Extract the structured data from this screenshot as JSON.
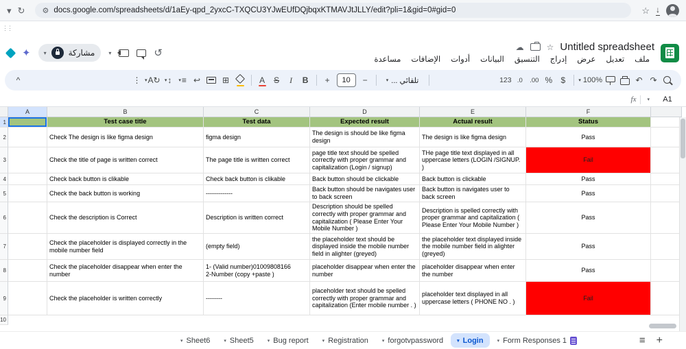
{
  "colors": {
    "header_green": "#a3c47f",
    "fail_red": "#ff0000",
    "active_blue": "#0b57d0",
    "active_tab_bg": "#d3e3fd",
    "toolbar_bg": "#edf2fa",
    "selection_blue": "#1a73e8",
    "sheets_green": "#118c46"
  },
  "browser": {
    "url": "docs.google.com/spreadsheets/d/1aEy-qpd_2yxcC-TXQCU3YJwEUfDQjbqxKTMAVJtJLLY/edit?pli=1&gid=0#gid=0"
  },
  "app": {
    "title": "Untitled spreadsheet",
    "share_label": "مشاركة",
    "menus": [
      "ملف",
      "تعديل",
      "عرض",
      "إدراج",
      "التنسيق",
      "البيانات",
      "أدوات",
      "الإضافات",
      "مساعدة"
    ]
  },
  "toolbar": {
    "font_size": "10",
    "font_name": "تلقائي ...",
    "zoom": "100%",
    "number_format": "123",
    "percent": "%",
    "currency": "$",
    "dec_decrease": ".0",
    "dec_increase": ".00",
    "bold": "B",
    "italic": "I",
    "strikethrough": "S",
    "text_color": "A",
    "plus": "+",
    "minus": "−"
  },
  "formula_bar": {
    "cell_ref": "A1",
    "fx_label": "fx"
  },
  "grid": {
    "columns": [
      "A",
      "B",
      "C",
      "D",
      "E",
      "F"
    ],
    "header_row": [
      "Test case title",
      "Test data",
      "Expected result",
      "Actual result",
      "Status"
    ],
    "rows": [
      {
        "title": "Check The  design is like figma design",
        "test_data": "figma design",
        "expected": "The  design is should be like figma design",
        "actual": "The  design is like figma design",
        "status": "Pass"
      },
      {
        "title": "Check the title of page is written correct",
        "test_data": "The page title is written correct",
        "expected": "page title text should be spelled correctly with proper grammar and capitalization   (Login / signup)",
        "actual": "THe page title text displayed in all uppercase letters (LOGIN /SIGNUP. )",
        "status": "Fail"
      },
      {
        "title": "Check back button is clikable",
        "test_data": "Check back button is clikable",
        "expected": "Back button should be clickable",
        "actual": "Back button is clickable",
        "status": "Pass"
      },
      {
        "title": "Check the back button is working",
        "test_data": "-------------",
        "expected": "Back button should be  navigates user to back screen",
        "actual": "Back button is  navigates user to back screen",
        "status": "Pass"
      },
      {
        "title": "Check the description is Correct",
        "test_data": "Description is written correct",
        "expected": "Description should be spelled correctly with proper grammar and capitalization   ( Please Enter Your Mobile Number  )",
        "actual": "Description is spelled  correctly with proper grammar and capitalization   ( Please Enter Your Mobile Number  )",
        "status": "Pass"
      },
      {
        "title": "Check the placeholder  is displayed correctly  in the mobile number field",
        "test_data": "(empty field)",
        "expected": "the placeholder text should be displayed inside the   mobile number field in alighter (greyed)",
        "actual": "the placeholder text  displayed inside the   mobile number field in alighter (greyed)",
        "status": "Pass"
      },
      {
        "title": "Check the placeholder disappear when enter the number",
        "test_data": "1- (Valid number)01009808166\n2-Number (copy +paste )",
        "expected": "placeholder disappear when enter the number",
        "actual": "placeholder disappear when enter the number",
        "status": "Pass"
      },
      {
        "title": "Check the placeholder is written correctly",
        "test_data": "--------",
        "expected": "placeholder text should be spelled correctly with proper grammar and capitalization   (Enter mobile number . )",
        "actual": "placeholder text displayed in all uppercase letters ( PHONE NO . )",
        "status": "Fail"
      }
    ]
  },
  "tabs": {
    "items": [
      {
        "label": "Sheet6",
        "active": false,
        "icon": false
      },
      {
        "label": "Sheet5",
        "active": false,
        "icon": false
      },
      {
        "label": "Bug report",
        "active": false,
        "icon": false
      },
      {
        "label": "Registration",
        "active": false,
        "icon": false
      },
      {
        "label": "forgotvpassword",
        "active": false,
        "icon": false
      },
      {
        "label": "Login",
        "active": true,
        "icon": false
      },
      {
        "label": "Form Responses 1",
        "active": false,
        "icon": true
      }
    ]
  }
}
